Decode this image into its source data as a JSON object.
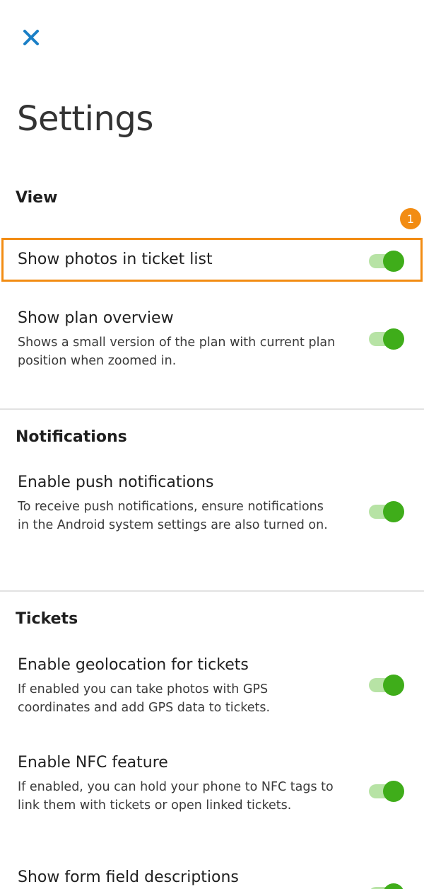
{
  "header": {
    "close_icon": "close-icon",
    "title": "Settings"
  },
  "colors": {
    "accent": "#1a7fc6",
    "toggle_on": "#3fad1a",
    "toggle_track": "#b7e3a5",
    "highlight": "#f28c13"
  },
  "annotation": {
    "marker": "1"
  },
  "sections": {
    "view": {
      "heading": "View",
      "show_photos": {
        "title": "Show photos in ticket list",
        "enabled": true
      },
      "plan_overview": {
        "title": "Show plan overview",
        "description": "Shows a small version of the plan with current plan position when zoomed in.",
        "enabled": true
      }
    },
    "notifications": {
      "heading": "Notifications",
      "push": {
        "title": "Enable push notifications",
        "description": "To receive push notifications, ensure notifications in the Android system settings are also turned on.",
        "enabled": true
      }
    },
    "tickets": {
      "heading": "Tickets",
      "geolocation": {
        "title": "Enable geolocation for tickets",
        "description": "If enabled you can take photos with GPS coordinates and add GPS data to tickets.",
        "enabled": true
      },
      "nfc": {
        "title": "Enable NFC feature",
        "description": "If enabled, you can hold your phone to NFC tags to link them with tickets or open linked tickets.",
        "enabled": true
      },
      "form_descriptions": {
        "title": "Show form field descriptions",
        "enabled": true
      }
    }
  }
}
